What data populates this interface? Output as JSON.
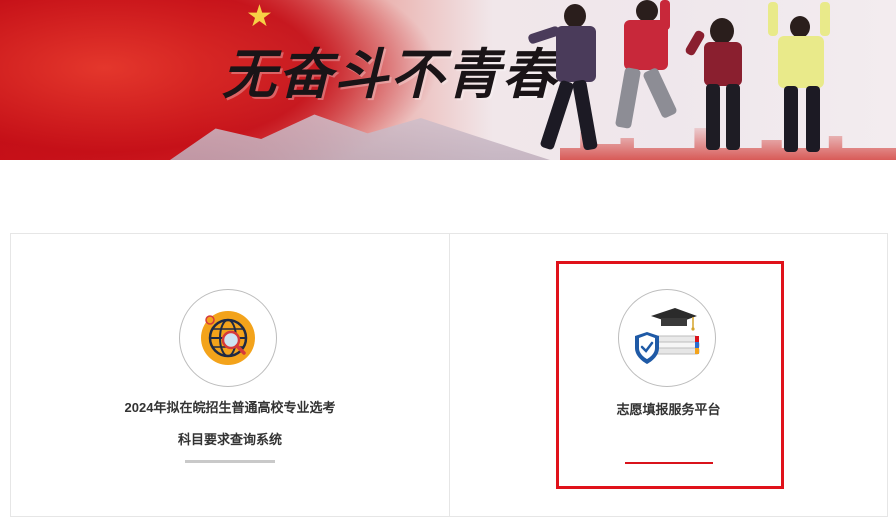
{
  "banner": {
    "slogan": "无奋斗不青春",
    "star_glyph": "★",
    "colors": {
      "red": "#c8101a",
      "gold": "#f7d046"
    }
  },
  "cards": [
    {
      "icon": "globe-search-icon",
      "title_line1": "2024年拟在皖招生普通高校专业选考",
      "title_line2": "科目要求查询系统"
    },
    {
      "icon": "graduation-books-shield-icon",
      "title_line1": "志愿填报服务平台"
    }
  ],
  "colors": {
    "highlight_border": "#e0111a",
    "accent_red": "#d9131b",
    "divider_gray": "#c9c9c9",
    "text": "#333333"
  }
}
